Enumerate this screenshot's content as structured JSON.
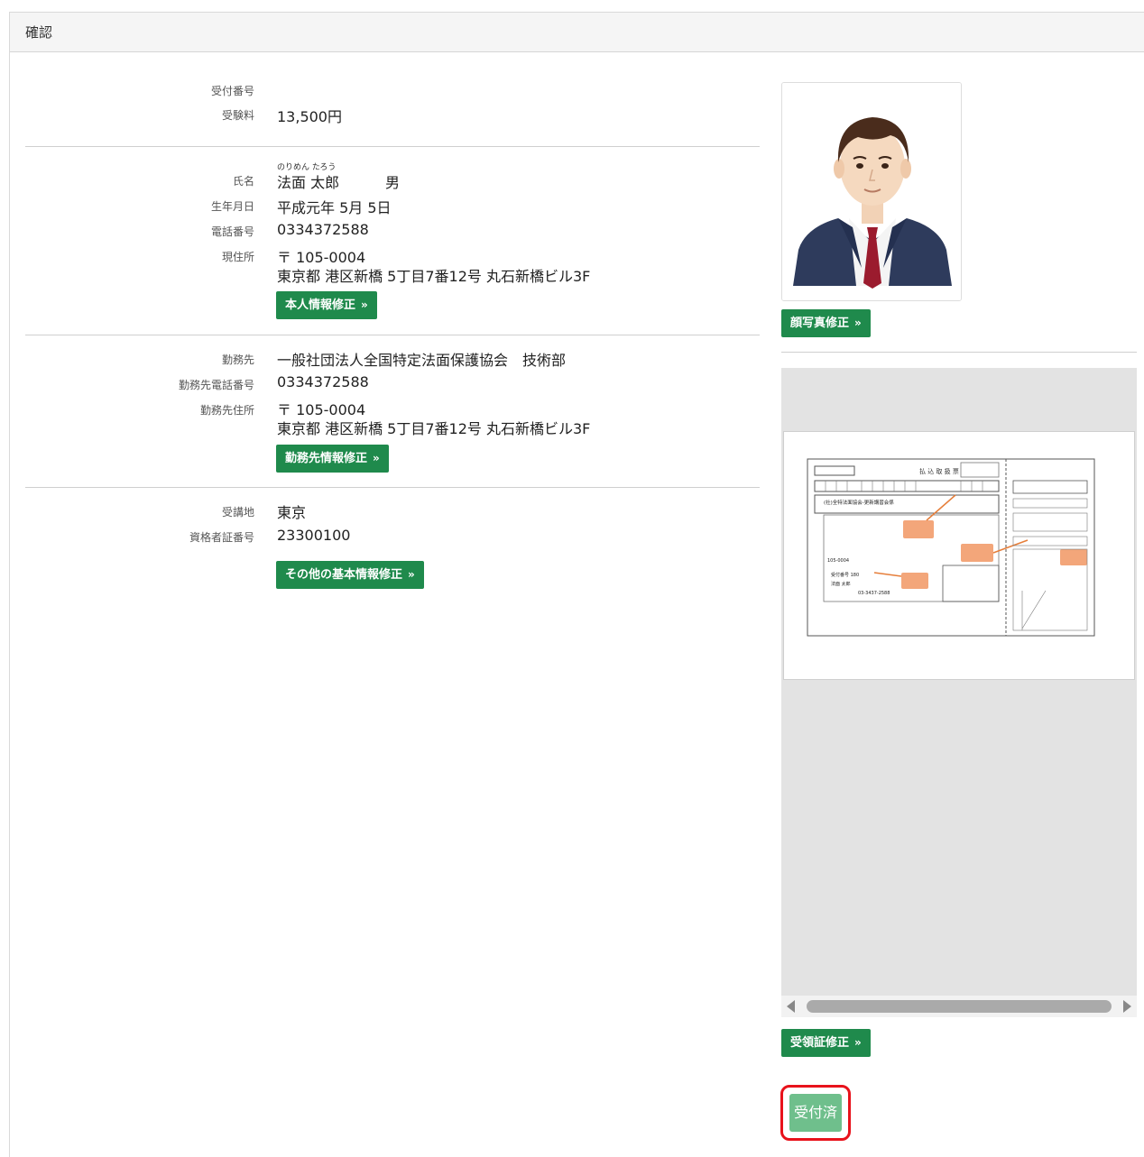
{
  "header": {
    "title": "確認"
  },
  "receipt": {
    "number_label": "受付番号",
    "number_value": "",
    "fee_label": "受験料",
    "fee_value": "13,500円"
  },
  "personal": {
    "name_label": "氏名",
    "name_ruby": "のりめん たろう",
    "name_value": "法面 太郎",
    "gender": "男",
    "birthdate_label": "生年月日",
    "birthdate_value": "平成元年 5月 5日",
    "phone_label": "電話番号",
    "phone_value": "0334372588",
    "address_label": "現住所",
    "address_zip": "〒 105-0004",
    "address_line": "東京都 港区新橋 5丁目7番12号 丸石新橋ビル3F",
    "edit_button": "本人情報修正"
  },
  "work": {
    "employer_label": "勤務先",
    "employer_value": "一般社団法人全国特定法面保護協会　技術部",
    "phone_label": "勤務先電話番号",
    "phone_value": "0334372588",
    "address_label": "勤務先住所",
    "address_zip": "〒 105-0004",
    "address_line": "東京都 港区新橋 5丁目7番12号 丸石新橋ビル3F",
    "edit_button": "勤務先情報修正"
  },
  "other": {
    "venue_label": "受講地",
    "venue_value": "東京",
    "cert_label": "資格者証番号",
    "cert_value": "23300100",
    "edit_button": "その他の基本情報修正"
  },
  "photo": {
    "edit_button": "顔写真修正"
  },
  "receipt_doc": {
    "form_title": "払 込 取 扱 票",
    "account_name": "(社)全特法面協会-更新講習会係",
    "zip": "105-0004",
    "receipt_no": "受付番号 180",
    "payer": "法面 太郎",
    "phone": "03-3437-2588",
    "edit_button": "受領証修正"
  },
  "status": {
    "accepted_button": "受付済"
  },
  "colors": {
    "primary_button": "#1f8a4c",
    "accepted_button": "#6fbf8c",
    "highlight": "#e8121b"
  }
}
